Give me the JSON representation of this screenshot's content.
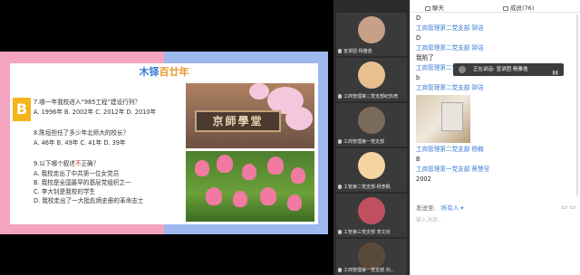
{
  "slide": {
    "header_part1": "木铎",
    "header_part2": "百廿年",
    "badge": "B",
    "questions": [
      {
        "text": "7.哪一年我校进入“985工程”建设行列？",
        "options": "A. 1996年    B. 2002年    C. 2012年    D. 2010年"
      },
      {
        "text": "8.陈垣担任了多少年北师大的校长？",
        "options": "A.   46年    B.  49年    C.  41年    D.  39年"
      }
    ],
    "q9": {
      "prefix": "9.以下哪个叙述",
      "highlight": "不",
      "suffix": "正确？",
      "options": [
        "A. 我校走出了中共第一位女党员",
        "B. 我校是全国最早的基层党组织之一",
        "C. 李大钊是我校的学生",
        "D. 我校走出了一大批彪炳史册的革命志士"
      ]
    },
    "sign_text": "京師學堂"
  },
  "participants": [
    {
      "name": "宣讲团 杨雅逸",
      "avatar_color": "#c8a088"
    },
    {
      "name": "工商管理第二党支部纪玖琦",
      "avatar_color": "#e8c090"
    },
    {
      "name": "工商管理第一党支部",
      "avatar_color": "#7a6a5a"
    },
    {
      "name": "工管第二党支部-杨李枫",
      "avatar_color": "#f5d4a0"
    },
    {
      "name": "工管第三党支部 李文欣",
      "avatar_color": "#c05060"
    },
    {
      "name": "工商管理第一党支部 刘...",
      "avatar_color": "#5a4a3a"
    }
  ],
  "chat": {
    "tab_chat": "聊天",
    "tab_members": "成员(76)",
    "messages": [
      {
        "body": "D"
      },
      {
        "sender": "工商管理第二党支部 钟洁",
        "body": "D"
      },
      {
        "sender": "工商管理第二党支部 钟洁",
        "body": "我陷了"
      },
      {
        "sender": "工商管理第二党支部 钟洁",
        "body": "b"
      },
      {
        "sender": "工商管理第二党支部 钟洁",
        "image": true
      },
      {
        "sender": "工商管理第二党支部 杨楠",
        "body": "B"
      },
      {
        "sender": "工商管理第一党支部 蔡慧莹",
        "body": "2002"
      }
    ],
    "speaker_label": "正在讲话: 宣讲团 杨雅逸",
    "send_to_label": "发送至:",
    "send_to_value": "所有人 ▾",
    "input_placeholder": "输入消息..."
  }
}
